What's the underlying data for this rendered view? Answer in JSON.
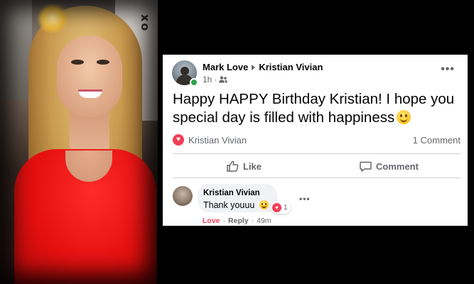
{
  "photo": {
    "wall_text": "xo"
  },
  "post": {
    "author": "Mark Love",
    "recipient": "Kristian Vivian",
    "time": "1h",
    "text": "Happy HAPPY Birthday Kristian! I hope you special day is filled with happiness",
    "reaction_name": "Kristian Vivian",
    "comment_count": "1 Comment",
    "like_label": "Like",
    "comment_label": "Comment",
    "more_dots": "•••"
  },
  "comment": {
    "author": "Kristian Vivian",
    "text": "Thank youuu",
    "reaction_count": "1",
    "more_dots": "•••",
    "love_label": "Love",
    "reply_label": "Reply",
    "separator": "·",
    "time": "49m"
  },
  "colors": {
    "accent_love": "#f33e58",
    "online": "#31a24c",
    "muted_text": "#65676b"
  }
}
